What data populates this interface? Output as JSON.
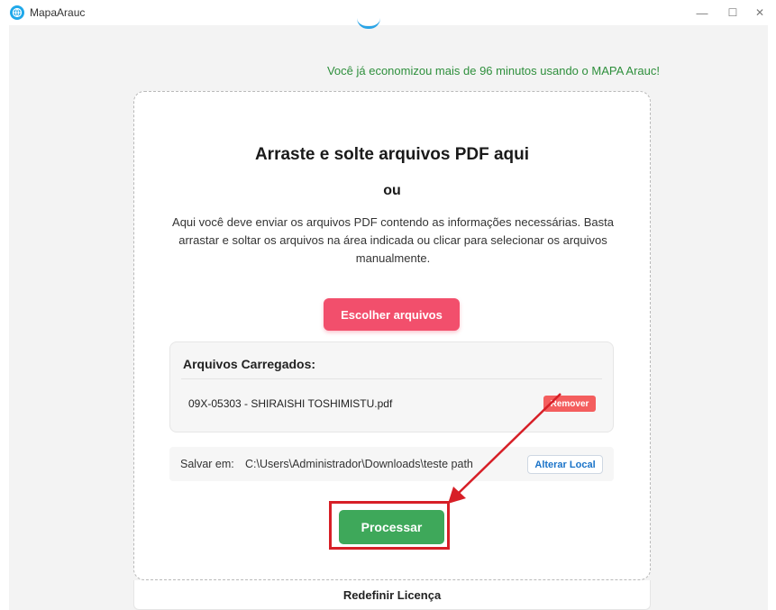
{
  "window": {
    "title": "MapaArauc",
    "controls": {
      "minimize": "—",
      "maximize": "☐",
      "close": "✕"
    }
  },
  "header": {
    "savings_message": "Você já economizou mais de 96 minutos usando o MAPA Arauc!"
  },
  "upload": {
    "title": "Arraste e solte arquivos PDF aqui",
    "or": "ou",
    "description": "Aqui você deve enviar os arquivos PDF contendo as informações necessárias. Basta arrastar e soltar os arquivos na área indicada ou clicar para selecionar os arquivos manualmente.",
    "choose_button": "Escolher arquivos"
  },
  "files": {
    "heading": "Arquivos Carregados:",
    "items": [
      {
        "name": "09X-05303 - SHIRAISHI TOSHIMISTU.pdf",
        "remove_label": "Remover"
      }
    ]
  },
  "save": {
    "label": "Salvar em:",
    "path": "C:\\Users\\Administrador\\Downloads\\teste path",
    "change_button": "Alterar Local"
  },
  "actions": {
    "process_button": "Processar"
  },
  "footer": {
    "license_label": "Redefinir Licença"
  },
  "colors": {
    "accent_pink": "#f24f6c",
    "success_green": "#3ea85a",
    "savings_text": "#2e8f3c",
    "annotation_red": "#d71f27",
    "link_blue": "#1a73c8"
  },
  "icons": {
    "app": "globe-icon",
    "arrow_annotation": "red-arrow-annotation"
  }
}
